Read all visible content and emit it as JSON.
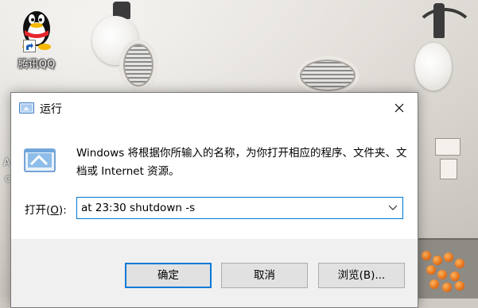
{
  "desktop": {
    "icons": [
      {
        "label": "腾讯QQ",
        "icon": "qq-penguin-icon"
      }
    ],
    "edge_text_1": "A",
    "edge_text_2": "c"
  },
  "dialog": {
    "title": "运行",
    "title_icon": "run-icon",
    "description": "Windows 将根据你所输入的名称，为你打开相应的程序、文件夹、文档或 Internet 资源。",
    "open_label": "打开(",
    "open_label_key": "O",
    "open_label_end": "):",
    "command_value": "at 23:30 shutdown -s",
    "buttons": {
      "ok": "确定",
      "cancel": "取消",
      "browse": "浏览(B)..."
    }
  },
  "colors": {
    "accent": "#0078d7",
    "dialog_bg": "#f0f0f0",
    "content_bg": "#ffffff"
  }
}
